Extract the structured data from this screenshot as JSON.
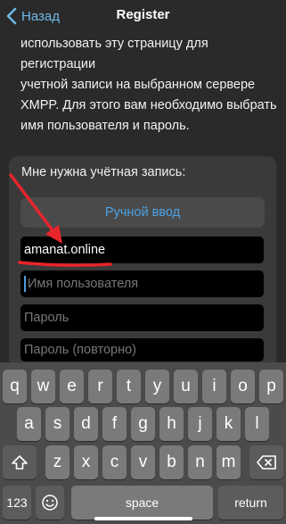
{
  "colors": {
    "accent": "#4aa3e6",
    "annotation": "#e8252b",
    "background": "#2a2a2a"
  },
  "nav": {
    "back_label": "Назад",
    "title": "Register",
    "back_icon": "chevron-left-icon"
  },
  "description": {
    "partial_top_line": "ользовать эту страницу для",
    "lines": [
      "использовать эту страницу для регистрации",
      "учетной записи на выбранном сервере",
      "XMPP. Для этого вам необходимо выбрать",
      "имя пользователя и пароль."
    ]
  },
  "form": {
    "section_label": "Мне нужна учётная запись:",
    "manual_button": "Ручной ввод",
    "server_value": "amanat.online",
    "username_placeholder": "Имя пользователя",
    "password_placeholder": "Пароль",
    "password_repeat_placeholder": "Пароль (повторно)"
  },
  "keyboard": {
    "row1": [
      "q",
      "w",
      "e",
      "r",
      "t",
      "y",
      "u",
      "i",
      "o",
      "p"
    ],
    "row2": [
      "a",
      "s",
      "d",
      "f",
      "g",
      "h",
      "j",
      "k",
      "l"
    ],
    "row3": [
      "z",
      "x",
      "c",
      "v",
      "b",
      "n",
      "m"
    ],
    "numbers": "123",
    "space": "space",
    "return": "return"
  }
}
